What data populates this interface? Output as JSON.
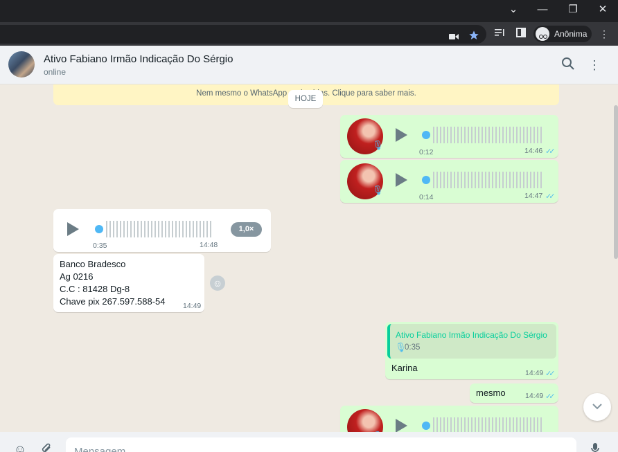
{
  "browser": {
    "window_controls": {
      "dropdown": "⌄",
      "minimize": "—",
      "restore": "❐",
      "close": "✕"
    },
    "incognito_label": "Anônima",
    "icons": [
      "camera-icon",
      "star-icon",
      "media-icon",
      "sidebar-icon",
      "incognito-icon",
      "menu-icon"
    ],
    "star_color": "#8ab4f8"
  },
  "chat": {
    "name": "Ativo Fabiano Irmão Indicação Do Sérgio",
    "status": "online"
  },
  "notice": {
    "visible_text": "Nem mesmo o WhatsApp pod   uvi-las. Clique para saber mais."
  },
  "day_chip": "HOJE",
  "messages": {
    "voice1": {
      "duration": "0:12",
      "time": "14:46",
      "ticks": "✓✓"
    },
    "voice2": {
      "duration": "0:14",
      "time": "14:47",
      "ticks": "✓✓"
    },
    "voice3": {
      "duration": "0:35",
      "time": "14:48",
      "speed": "1,0×"
    },
    "bank": {
      "lines": [
        "Banco Bradesco",
        "Ag 0216",
        "C.C : 81428 Dg-8",
        "Chave pix 267.597.588-54"
      ],
      "time": "14:49"
    },
    "reply": {
      "quoted_name": "Ativo Fabiano Irmão Indicação Do Sérgio",
      "quoted_duration": "0:35",
      "text": "Karina",
      "time": "14:49",
      "ticks": "✓✓"
    },
    "mesmo": {
      "text": "mesmo",
      "time": "14:49",
      "ticks": "✓✓"
    }
  },
  "composer": {
    "placeholder": "Mensagem"
  },
  "colors": {
    "outgoing_bubble": "#d9fdd3",
    "incoming_bubble": "#ffffff",
    "chat_bg": "#efeae2",
    "read_ticks": "#53bdeb",
    "quote_accent": "#06cf9c"
  }
}
